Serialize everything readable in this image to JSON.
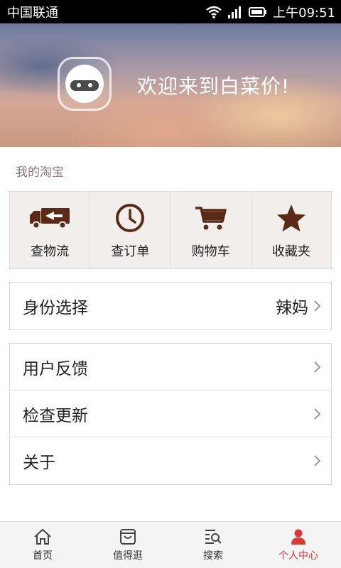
{
  "status_bar": {
    "carrier": "中国联通",
    "time": "上午09:51"
  },
  "header": {
    "welcome": "欢迎来到白菜价!"
  },
  "my_taobao": {
    "label": "我的淘宝",
    "items": [
      {
        "label": "查物流",
        "icon": "truck-icon"
      },
      {
        "label": "查订单",
        "icon": "clock-icon"
      },
      {
        "label": "购物车",
        "icon": "cart-icon"
      },
      {
        "label": "收藏夹",
        "icon": "star-icon"
      }
    ]
  },
  "identity": {
    "label": "身份选择",
    "value": "辣妈"
  },
  "settings": [
    {
      "label": "用户反馈"
    },
    {
      "label": "检查更新"
    },
    {
      "label": "关于"
    }
  ],
  "tabbar": [
    {
      "label": "首页",
      "icon": "home-icon"
    },
    {
      "label": "值得逛",
      "icon": "bag-icon"
    },
    {
      "label": "搜索",
      "icon": "search-icon"
    },
    {
      "label": "个人中心",
      "icon": "person-icon",
      "active": true
    }
  ],
  "colors": {
    "icon_brown": "#5a2a16",
    "active_red": "#d83a3a"
  }
}
